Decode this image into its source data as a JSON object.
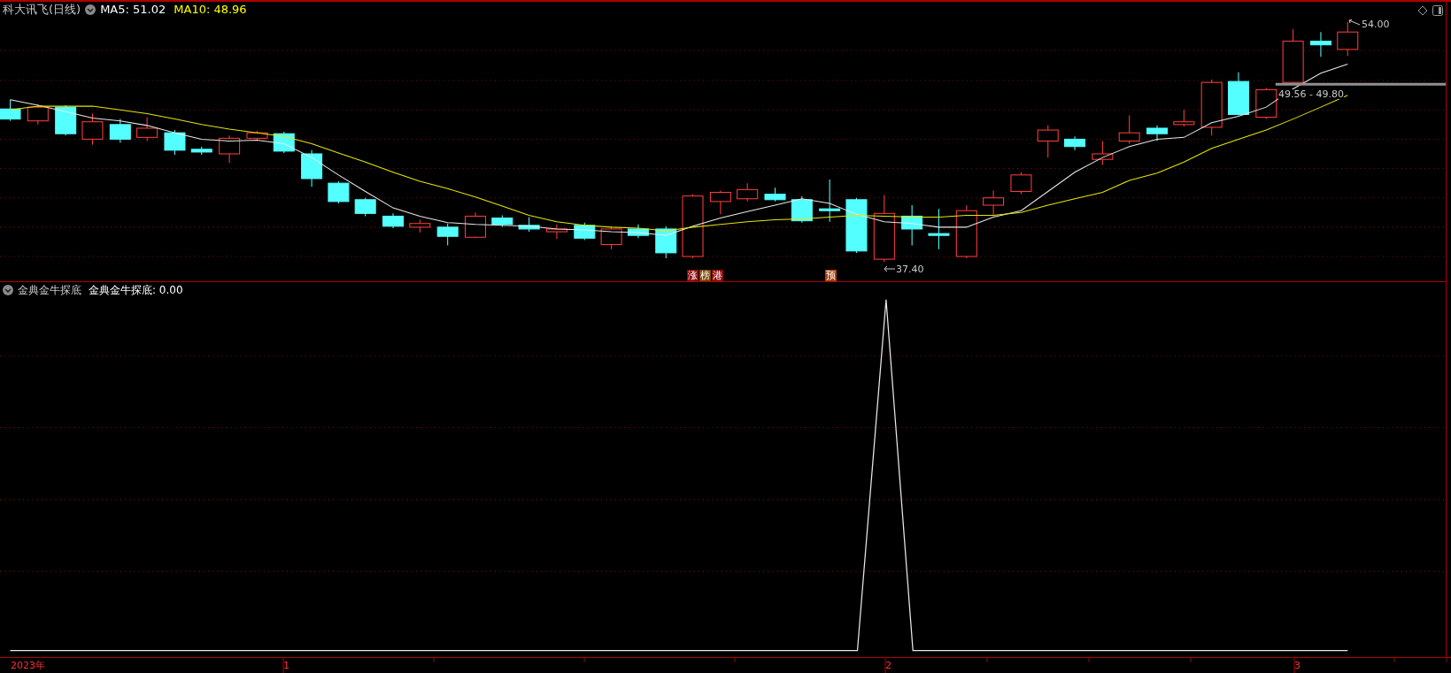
{
  "title": "科大讯飞(日线)",
  "ma5": "MA5: 51.02",
  "ma10": "MA10: 48.96",
  "price_labels": {
    "high": "54.00",
    "range": "49.56 - 49.80",
    "low": "37.40"
  },
  "badges": [
    {
      "text": "涨",
      "color": "#8b0a0a"
    },
    {
      "text": "榜",
      "color": "#7a4a08"
    },
    {
      "text": "港",
      "color": "#8b0a0a"
    },
    {
      "text": "预",
      "color": "#a8420c"
    }
  ],
  "indicator": {
    "name": "金典金牛探底",
    "value": "金典金牛探底: 0.00"
  },
  "axis_labels": [
    "2023年",
    "1",
    "2",
    "3"
  ]
}
